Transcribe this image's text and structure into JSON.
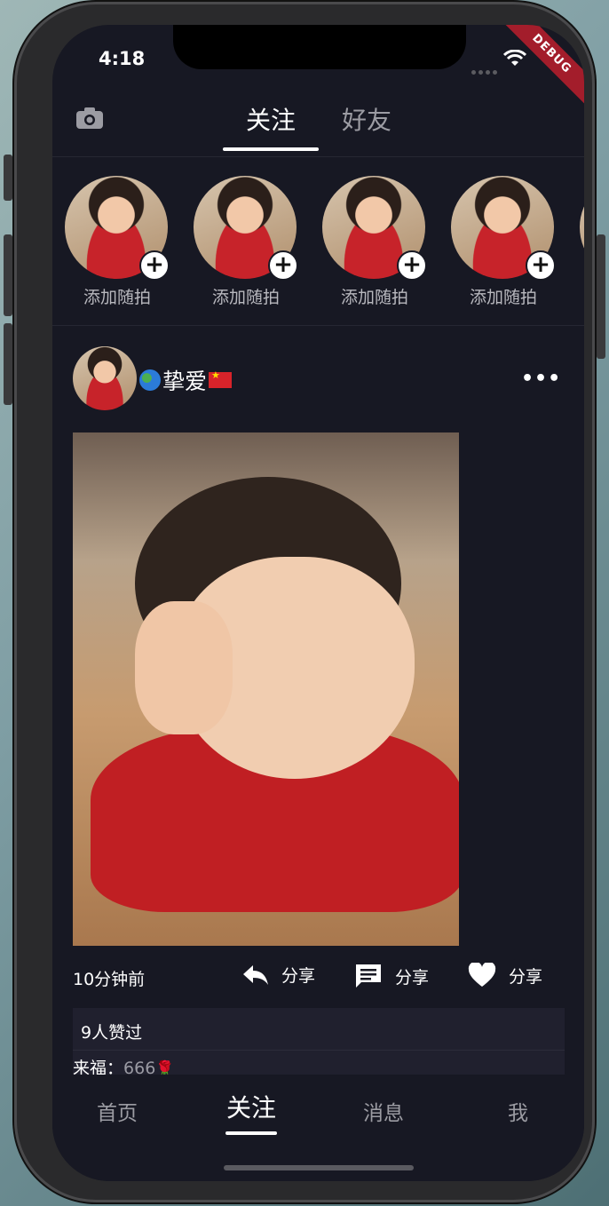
{
  "status_bar": {
    "time": "4:18",
    "debug_label": "DEBUG"
  },
  "top_bar": {
    "camera_icon": "camera-icon",
    "tabs": [
      {
        "label": "关注",
        "active": true
      },
      {
        "label": "好友",
        "active": false
      }
    ]
  },
  "stories": [
    {
      "label": "添加随拍"
    },
    {
      "label": "添加随拍"
    },
    {
      "label": "添加随拍"
    },
    {
      "label": "添加随拍"
    }
  ],
  "post": {
    "author_name": "挚爱",
    "time_ago": "10分钟前",
    "actions": [
      {
        "icon": "reply-icon",
        "label": "分享"
      },
      {
        "icon": "comment-icon",
        "label": "分享"
      },
      {
        "icon": "heart-icon",
        "label": "分享"
      }
    ],
    "likes_text": "9人赞过",
    "comment": {
      "author": "来福：",
      "text": "666"
    }
  },
  "bottom_nav": [
    {
      "label": "首页",
      "active": false
    },
    {
      "label": "关注",
      "active": true
    },
    {
      "label": "消息",
      "active": false
    },
    {
      "label": "我",
      "active": false
    }
  ],
  "colors": {
    "background": "#171823",
    "panel": "#20202e",
    "inactive_text": "#9c9ca3",
    "debug_banner": "#a31d2b"
  }
}
